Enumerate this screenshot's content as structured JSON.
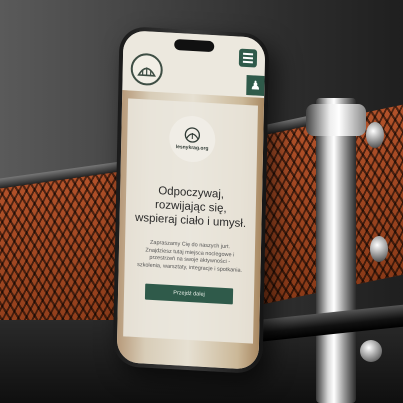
{
  "site": {
    "logo_text": "lesnykrag.org",
    "headline": "Odpoczywaj, rozwijając się, wspieraj ciało i umysł.",
    "body": "Zapraszamy Cię do naszych jurt. Znajdziesz tutaj miejsca noclegowe i przestrzeń na swoje aktywności - szkolenia, warsztaty, integracje i spotkania.",
    "cta_label": "Przejdź dalej",
    "accessibility_icon": "accessibility-icon",
    "menu_icon": "hamburger-menu-icon",
    "colors": {
      "brand_green": "#2f5a4a",
      "background_beige": "#e3ded2",
      "mesh_orange": "#b3522a"
    }
  }
}
